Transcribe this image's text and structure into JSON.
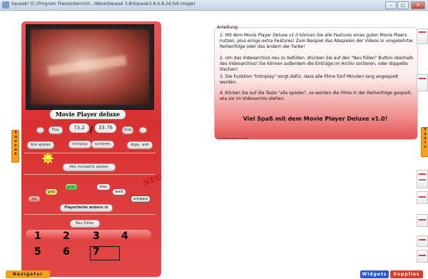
{
  "window": {
    "title": "Squeak! (C:\\Program Files\\Unterricht...\\Ware\\Squeak 3.8\\Squeak3.8-6.6.2d.full.image)",
    "buttons": [
      "–",
      "□",
      "✕"
    ]
  },
  "player": {
    "title": "Movie Player deluxe",
    "play_label": "Play",
    "stop_label": "Stop",
    "time_current": "73.2",
    "time_separator": "/",
    "time_total": "33.76",
    "alle_spielen": "Alle spielen",
    "introplay": "Introplay",
    "sortieren": "sortieren",
    "doppelt": "dopp. weit",
    "star_label": "Special",
    "alle_rueckwaerts": "Alle rückwärts spielen",
    "neu_badge": "NEU",
    "colors": {
      "gruen": "grün",
      "gelb": "gelb",
      "blau": "blau",
      "rot": "rot",
      "weiss": "weiß",
      "schwarz": "schwarz"
    },
    "playerfarbe": "Playerfarbe ändern in",
    "neu_fuellen": "Neu Füllen",
    "numbers": [
      "1",
      "2",
      "3",
      "4",
      "5",
      "6",
      "7"
    ]
  },
  "anleitung": {
    "title": "Anleitung:",
    "items": [
      "1. Mit dem Movie Player Deluxe v1.0 können Sie alle Features eines guten Movie Plaers nutzen, plus einige extra Features! Zum Beispiel das Abspielen der Videos in umgekehrter Reihenfolge oder das ändern der Farbe!",
      "2. Um das Videoarchivs neu zu befüllen, drücken Sie auf den \"Neu füllen\" Button oberhalb des Videoarchivs! Sie können außerdem die Einträge im Archiv sortieren, oder doppelte löschen!",
      "3. Die Funktion \"Introplay\" sorgt dafür, dass alle Filme fünf Minuten lang angespielt werden.",
      "4. Klicken Sie auf die Taste \"alle spielen\", so werden die Filme in der Reihenfolge gespielt, wie sie im Videoarchiv stehen."
    ],
    "closing": "Viel Spaß mit dem Movie Player Deluxe v1.0!",
    "copyright": "(C) Sebastian Brammer 2007"
  },
  "flaps": {
    "left": "Squeak",
    "right": "Tools",
    "bottom_left": "Navigator",
    "bottom_right_1": "Widgets",
    "bottom_right_2": "Supplies"
  },
  "colors": {
    "panel": "#d83030",
    "flap": "#f7a01b",
    "widgets": "#2c57d6",
    "supplies": "#e23a2a"
  }
}
